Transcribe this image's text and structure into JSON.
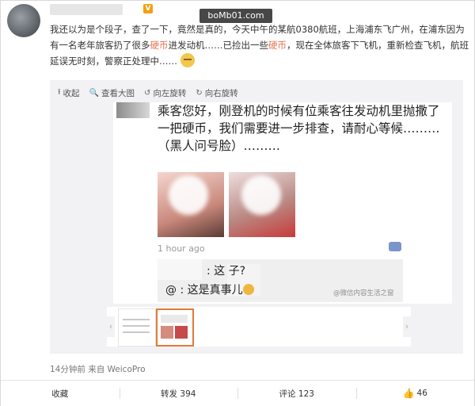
{
  "post": {
    "watermark": "boMb01.com",
    "badge": "V",
    "text_before": "我还以为是个段子，查了一下，竟然是真的，今天中午的某航0380航班，上海浦东飞广州，在浦东因为有一名老年旅客扔了很多",
    "hl1": "硬币",
    "text_mid1": "进发动机……已捡出一些",
    "hl2": "硬币",
    "text_mid2": "，现在全体旅客下飞机，重新检查飞机，航班延误无时刻，警察正处理中……",
    "source": "14分钟前 来自 WeicoPro"
  },
  "toolbar": {
    "collapse": "收起",
    "view_large": "查看大图",
    "rotate_left": "向左旋转",
    "rotate_right": "向右旋转"
  },
  "image": {
    "chat_text": "乘客您好，刚登机的时候有位乘客往发动机里抛撒了一把硬币，我们需要进一步排查，请耐心等候………（黑人问号脸）………",
    "time": "1 hour ago",
    "comment1": ": 这   子?",
    "comment2_a": "@",
    "comment2_b": ": 这是真事儿",
    "credit": "@微信内容生活之窗"
  },
  "actions": {
    "favorite": "收藏",
    "repost": "转发 394",
    "comment": "评论 123",
    "like": "46"
  },
  "icons": [
    "collapse-icon",
    "zoom-icon",
    "rotate-left-icon",
    "rotate-right-icon",
    "wechat-icon",
    "thumbs-up-icon"
  ]
}
